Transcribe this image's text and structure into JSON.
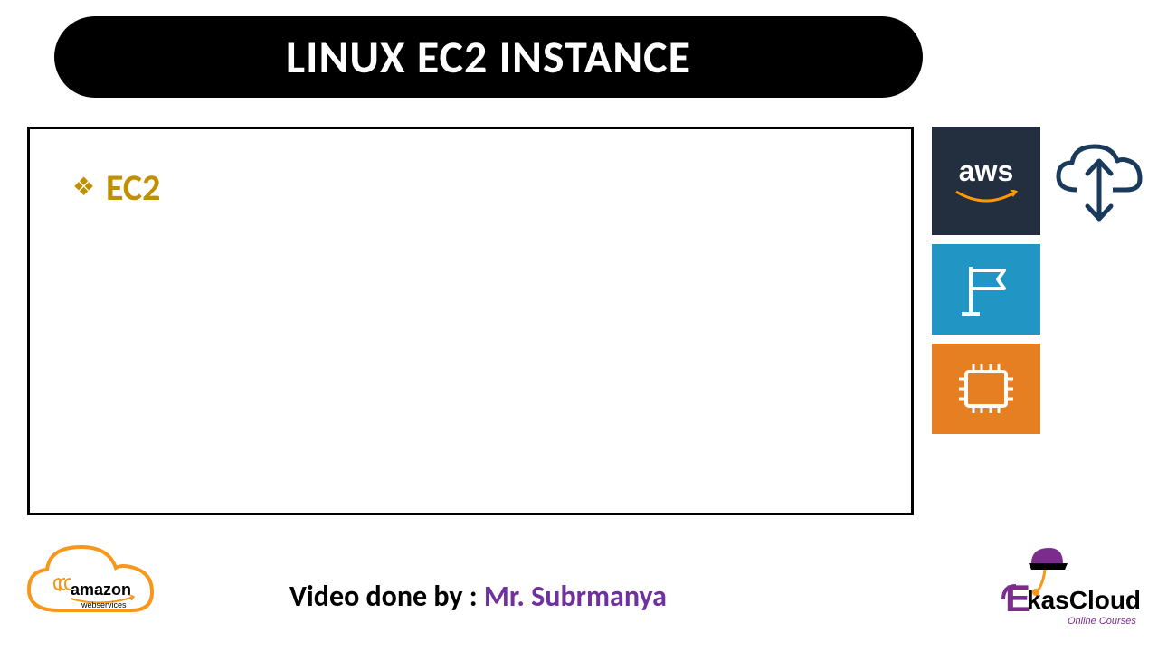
{
  "title": "LINUX EC2 INSTANCE",
  "content": {
    "bullet1": "EC2"
  },
  "icons": {
    "aws_label": "aws",
    "amazon_label": "amazon",
    "amazon_sublabel": "webservices",
    "ekas_prefix": "E",
    "ekas_text": "kasCloud",
    "ekas_subtext": "Online Courses"
  },
  "footer": {
    "label": "Video done by : ",
    "name": "Mr. Subrmanya"
  }
}
